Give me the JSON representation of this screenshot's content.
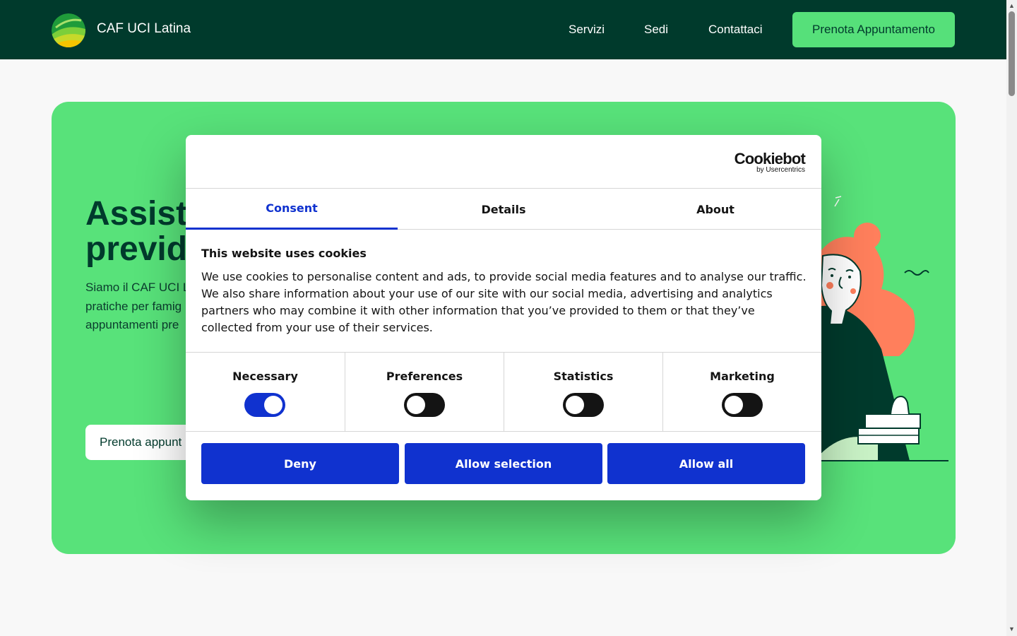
{
  "header": {
    "brand": "CAF UCI Latina",
    "nav": [
      "Servizi",
      "Sedi",
      "Contattaci"
    ],
    "cta_label": "Prenota Appuntamento",
    "colors": {
      "background": "#003a2c",
      "accent": "#56e07a"
    }
  },
  "hero": {
    "title_line1": "Assiste",
    "title_line2": "previd",
    "text_line1": "Siamo il CAF UCI L",
    "text_line2": "pratiche per famig",
    "text_line3": "appuntamenti pre",
    "cta_label": "Prenota appunt",
    "background": "#58e27a"
  },
  "cookie_dialog": {
    "logo": {
      "word": "Cookiebot",
      "sub": "by Usercentrics"
    },
    "tabs": [
      {
        "label": "Consent",
        "active": true
      },
      {
        "label": "Details",
        "active": false
      },
      {
        "label": "About",
        "active": false
      }
    ],
    "heading": "This website uses cookies",
    "body": "We use cookies to personalise content and ads, to provide social media features and to analyse our traffic. We also share information about your use of our site with our social media, advertising and analytics partners who may combine it with other information that you’ve provided to them or that they’ve collected from your use of their services.",
    "toggles": [
      {
        "label": "Necessary",
        "on": true
      },
      {
        "label": "Preferences",
        "on": false
      },
      {
        "label": "Statistics",
        "on": false
      },
      {
        "label": "Marketing",
        "on": false
      }
    ],
    "buttons": {
      "deny": "Deny",
      "allow_selection": "Allow selection",
      "allow_all": "Allow all"
    },
    "colors": {
      "accent": "#1032cf",
      "text": "#141414"
    }
  },
  "scrollbar": {
    "up_icon": "▲",
    "down_icon": "▼"
  }
}
